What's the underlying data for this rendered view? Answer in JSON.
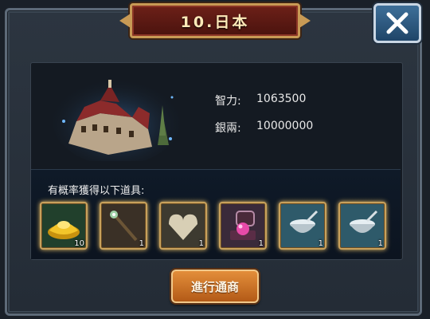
{
  "dialog": {
    "title": "10.日本",
    "close_icon": "close-icon"
  },
  "city": {
    "image": "castle-building",
    "stats": [
      {
        "label": "智力:",
        "value": "1063500"
      },
      {
        "label": "銀兩:",
        "value": "10000000"
      }
    ]
  },
  "rewards": {
    "title": "有概率獲得以下道具:",
    "items": [
      {
        "icon": "gold-ingot-icon",
        "count": "10"
      },
      {
        "icon": "magic-staff-icon",
        "count": "1"
      },
      {
        "icon": "heart-stone-icon",
        "count": "1"
      },
      {
        "icon": "pink-pearl-ring-box-icon",
        "count": "1"
      },
      {
        "icon": "silver-bowl-icon",
        "count": "1"
      },
      {
        "icon": "silver-bowl-icon",
        "count": "1"
      }
    ]
  },
  "actions": {
    "trade_label": "進行通商"
  },
  "colors": {
    "accent_gold": "#c8a15c",
    "title_red": "#6d2018",
    "button_orange": "#e38e3a"
  }
}
